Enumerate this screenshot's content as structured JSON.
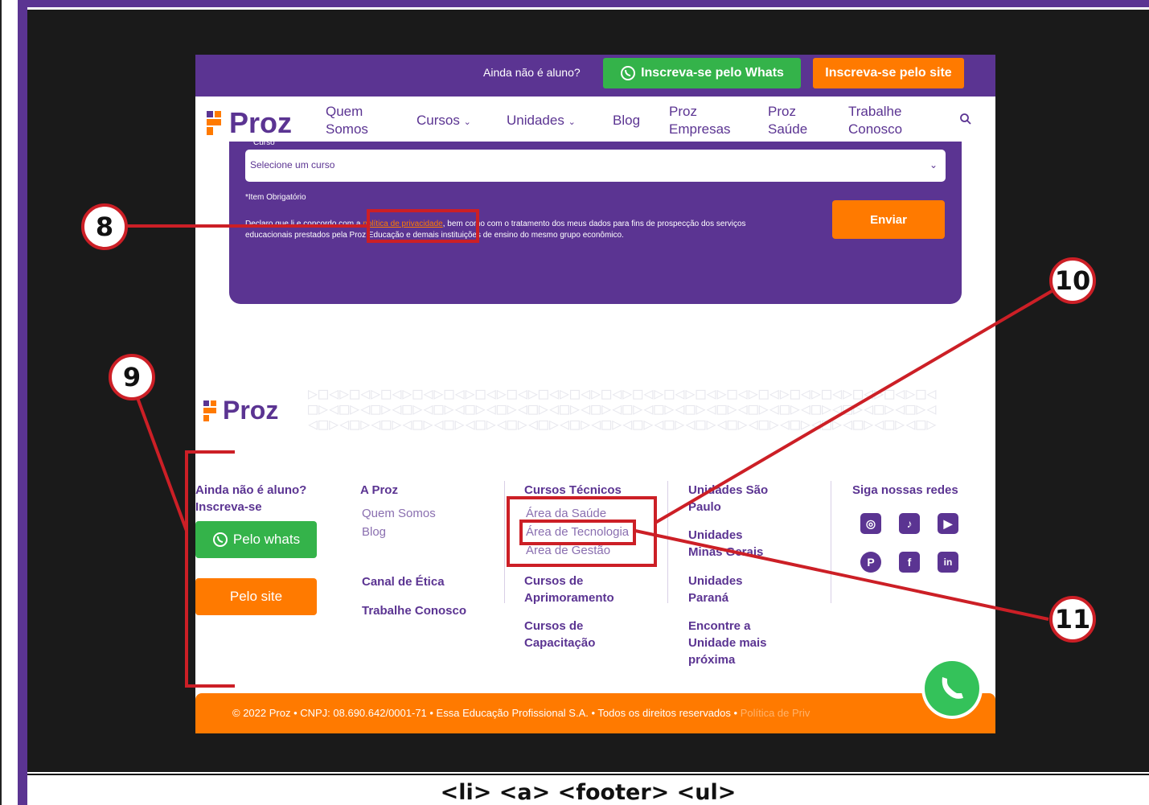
{
  "topbar": {
    "prompt": "Ainda não é aluno?",
    "whats_button": "Inscreva-se pelo Whats",
    "site_button": "Inscreva-se pelo site"
  },
  "brand": {
    "name": "Proz",
    "color": "#5b3492",
    "accent": "#ff7a00",
    "whatsapp_green": "#34b34a"
  },
  "nav": {
    "items": [
      {
        "label": "Quem Somos"
      },
      {
        "label": "Cursos"
      },
      {
        "label": "Unidades"
      },
      {
        "label": "Blog"
      },
      {
        "label": "Proz Empresas"
      },
      {
        "label": "Proz Saúde"
      },
      {
        "label": "Trabalhe Conosco"
      }
    ],
    "search_icon": "search-icon"
  },
  "form": {
    "curso_label": "Curso",
    "select_placeholder": "Selecione um curso",
    "required_note": "*Item Obrigatório",
    "consent_before": "Declaro que li e concordo com a ",
    "consent_link": "política de privacidade",
    "consent_after": ", bem como com o tratamento dos meus dados para fins de prospecção dos serviços educacionais prestados pela Proz Educação e demais instituições de ensino do mesmo grupo econômico.",
    "submit": "Enviar"
  },
  "footer": {
    "logo": "Proz",
    "col1": {
      "title": "Ainda não é aluno? Inscreva-se",
      "whats": "Pelo whats",
      "site": "Pelo site"
    },
    "col2": {
      "title": "A Proz",
      "links": [
        "Quem Somos",
        "Blog"
      ],
      "extra": [
        "Canal de Ética",
        "Trabalhe Conosco"
      ]
    },
    "col3": {
      "title": "Cursos Técnicos",
      "links": [
        "Área da Saúde",
        "Área de Tecnologia",
        "Área de Gestão"
      ],
      "group2": "Cursos de Aprimoramento",
      "group3": "Cursos de Capacitação"
    },
    "col4": {
      "items": [
        "Unidades São Paulo",
        "Unidades Minas Gerais",
        "Unidades Paraná",
        "Encontre a Unidade mais próxima"
      ]
    },
    "col5": {
      "title": "Siga nossas redes",
      "icons": [
        "instagram-icon",
        "tiktok-icon",
        "youtube-icon",
        "pinterest-icon",
        "facebook-icon",
        "linkedin-icon"
      ]
    },
    "copyright": "© 2022 Proz • CNPJ: 08.690.642/0001-71 • Essa Educação Profissional S.A. • Todos os direitos reservados •",
    "privacy_link": "Política de Priv"
  },
  "annotations": {
    "callouts": [
      "8",
      "9",
      "10",
      "11"
    ],
    "caption": "<li> <a> <footer> <ul>",
    "highlight_color": "#cc1f26"
  }
}
